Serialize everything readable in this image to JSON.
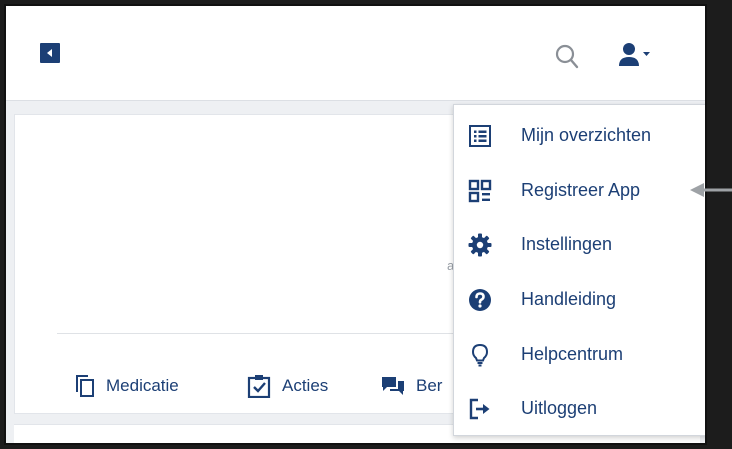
{
  "header": {
    "back_icon": "collapse-left-icon",
    "search_icon": "search-icon",
    "user_icon": "user-dropdown-icon"
  },
  "main": {
    "stray_text": "a",
    "tabs": [
      {
        "label": "Medicatie",
        "icon": "copy-icon"
      },
      {
        "label": "Acties",
        "icon": "checklist-icon"
      },
      {
        "label": "Ber",
        "icon": "chat-icon"
      }
    ]
  },
  "user_menu": {
    "items": [
      {
        "label": "Mijn overzichten",
        "icon": "list-icon"
      },
      {
        "label": "Registreer App",
        "icon": "qr-code-icon"
      },
      {
        "label": "Instellingen",
        "icon": "gear-icon"
      },
      {
        "label": "Handleiding",
        "icon": "help-icon"
      },
      {
        "label": "Helpcentrum",
        "icon": "lightbulb-icon"
      },
      {
        "label": "Uitloggen",
        "icon": "logout-icon"
      }
    ]
  },
  "colors": {
    "brand_navy": "#1c3f75",
    "icon_grey": "#8a8f96",
    "page_bg": "#eef0f3",
    "frame_dark": "#1c1c1c"
  }
}
